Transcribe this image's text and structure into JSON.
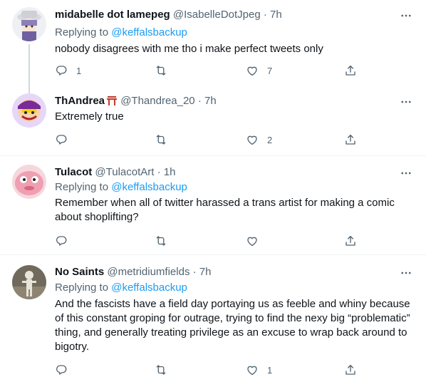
{
  "tweets": [
    {
      "name": "midabelle dot lamepeg",
      "handle": "@IsabelleDotJpeg",
      "time": "7h",
      "reply_prefix": "Replying to ",
      "reply_to": "@keffalsbackup",
      "text": "nobody disagrees with me tho i make perfect tweets only",
      "replies": "1",
      "retweets": "",
      "likes": "7"
    },
    {
      "name": "ThAndrea",
      "handle": "@Thandrea_20",
      "time": "7h",
      "text": "Extremely true",
      "replies": "",
      "retweets": "",
      "likes": "2"
    },
    {
      "name": "Tulacot",
      "handle": "@TulacotArt",
      "time": "1h",
      "reply_prefix": "Replying to ",
      "reply_to": "@keffalsbackup",
      "text": "Remember when all of twitter harassed a trans artist for making a comic about shoplifting?",
      "replies": "",
      "retweets": "",
      "likes": ""
    },
    {
      "name": "No Saints",
      "handle": "@metridiumfields",
      "time": "7h",
      "reply_prefix": "Replying to ",
      "reply_to": "@keffalsbackup",
      "text": "And the fascists have a field day portaying us as feeble and whiny because of this constant groping for outrage, trying to find the nexy big “problematic” thing, and generally treating privilege as an excuse to wrap back around to bigotry.",
      "replies": "",
      "retweets": "",
      "likes": "1"
    }
  ],
  "dot": "·",
  "colors": {
    "link": "#1d9bf0",
    "secondary": "#536471",
    "divider": "#eff3f4"
  },
  "icons": [
    "reply-icon",
    "retweet-icon",
    "like-icon",
    "share-icon",
    "more-icon"
  ]
}
